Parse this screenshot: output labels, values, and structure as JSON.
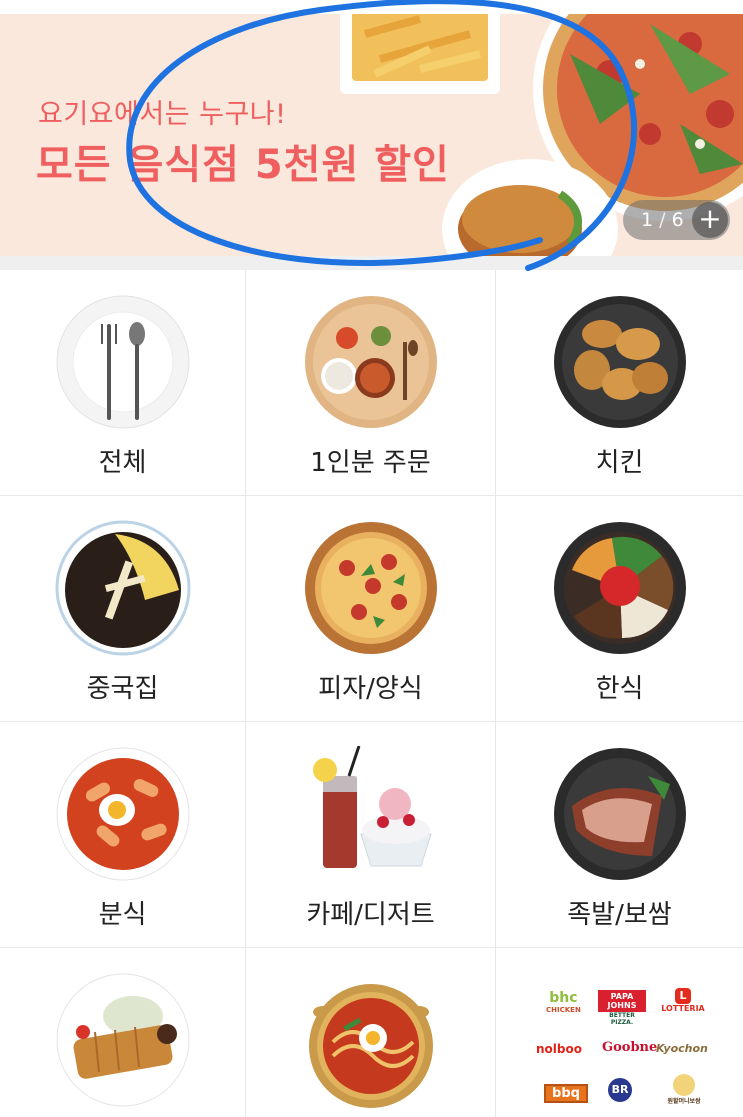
{
  "banner": {
    "subtitle": "요기요에서는 누구나!",
    "title": "모든 음식점 5천원 할인",
    "pager_current": "1",
    "pager_separator": "/",
    "pager_total": "6",
    "pager_plus": "+",
    "accent_color": "#ef5f5f"
  },
  "categories": [
    {
      "label": "전체",
      "icon": "utensils-plate-icon"
    },
    {
      "label": "1인분 주문",
      "icon": "single-meal-tray-icon"
    },
    {
      "label": "치킨",
      "icon": "fried-chicken-icon"
    },
    {
      "label": "중국집",
      "icon": "jajangmyeon-icon"
    },
    {
      "label": "피자/양식",
      "icon": "pizza-icon"
    },
    {
      "label": "한식",
      "icon": "bibimbap-icon"
    },
    {
      "label": "분식",
      "icon": "tteokbokki-icon"
    },
    {
      "label": "카페/디저트",
      "icon": "dessert-drink-icon"
    },
    {
      "label": "족발/보쌈",
      "icon": "jokbal-icon"
    },
    {
      "label": "",
      "icon": "tonkatsu-icon"
    },
    {
      "label": "",
      "icon": "ramen-pot-icon"
    },
    {
      "label": "",
      "icon": "franchise-logos-icon"
    }
  ],
  "franchise_logos": {
    "bhc": "bhc",
    "bhc_sub": "CHICKEN",
    "papajohns": "PAPA JOHNS",
    "papajohns_sub": "BETTER PIZZA.",
    "lotteria": "LOTTERIA",
    "lotteria_mark": "L",
    "nolboo": "nolboo",
    "goobne": "Goobne",
    "kyochon": "Kyochon",
    "bbq": "bbq",
    "br": "BR",
    "bossam": "원할머니보쌈"
  }
}
